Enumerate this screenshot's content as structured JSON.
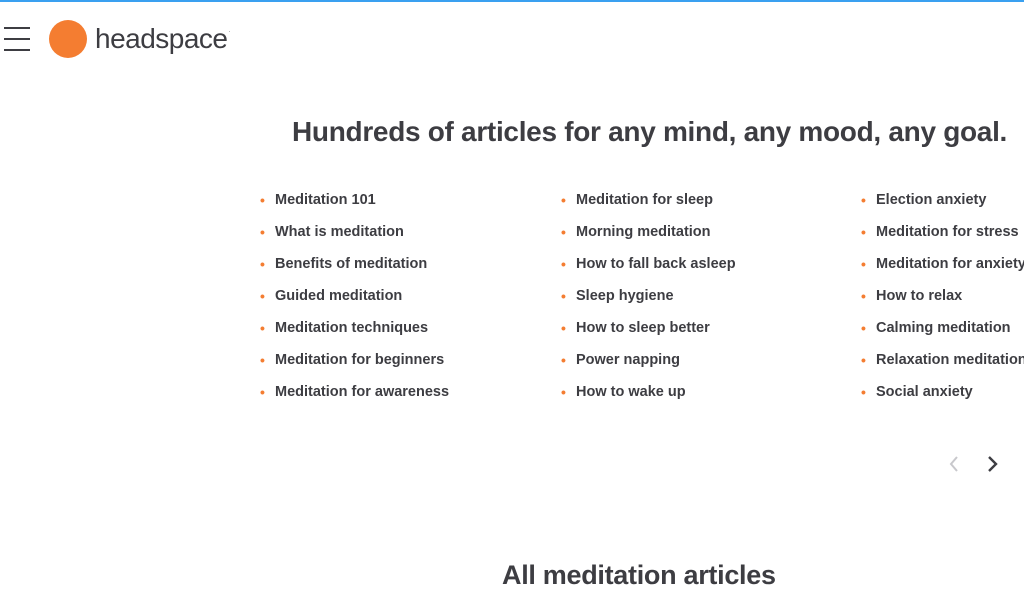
{
  "header": {
    "brand": "headspace",
    "brand_mark": "·",
    "menu_icon": "hamburger-menu-icon",
    "logo_color": "#f47d31",
    "top_bar_color": "#3aa0f0"
  },
  "main": {
    "headline": "Hundreds of articles for any mind, any mood, any goal.",
    "columns": [
      {
        "items": [
          "Meditation 101",
          "What is meditation",
          "Benefits of meditation",
          "Guided meditation",
          "Meditation techniques",
          "Meditation for beginners",
          "Meditation for awareness"
        ]
      },
      {
        "items": [
          "Meditation for sleep",
          "Morning meditation",
          "How to fall back asleep",
          "Sleep hygiene",
          "How to sleep better",
          "Power napping",
          "How to wake up"
        ]
      },
      {
        "items": [
          "Election anxiety",
          "Meditation for stress",
          "Meditation for anxiety",
          "How to relax",
          "Calming meditation",
          "Relaxation meditation",
          "Social anxiety"
        ]
      }
    ],
    "carousel": {
      "prev_icon": "chevron-left-icon",
      "next_icon": "chevron-right-icon",
      "prev_enabled": false,
      "next_enabled": true
    },
    "bullet": "•",
    "subheading": "All meditation articles"
  }
}
